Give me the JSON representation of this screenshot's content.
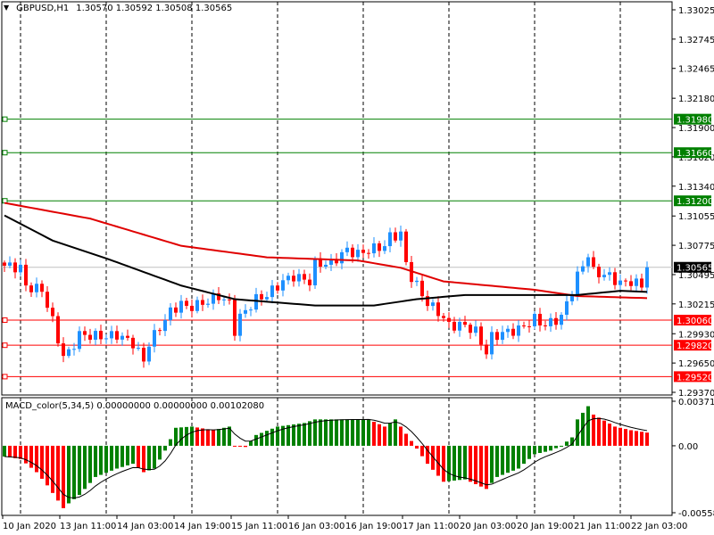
{
  "header": {
    "symbol": "GBPUSD,H1",
    "ohlc": "1.30570 1.30592 1.30508 1.30565"
  },
  "macd_label": "MACD_color(5,34,5) 0.00000000 0.00000000 0.00102080",
  "colors": {
    "up": "#1e90ff",
    "down": "#ff0000",
    "green_line": "#008000",
    "red_line": "#ff0000",
    "ma_slow": "#e00000",
    "ma_fast": "#000000",
    "macd_up": "#008000",
    "macd_down": "#ff0000"
  },
  "chart_data": [
    {
      "type": "candlestick",
      "title": "GBPUSD,H1",
      "ylim": [
        1.2937,
        1.33025
      ],
      "price_ticks": [
        "1.33025",
        "1.32745",
        "1.32465",
        "1.32180",
        "1.31900",
        "1.31620",
        "1.31340",
        "1.31055",
        "1.30775",
        "1.30495",
        "1.30215",
        "1.29930",
        "1.29650",
        "1.29370"
      ],
      "x_labels": [
        "10 Jan 2020",
        "13 Jan 11:00",
        "14 Jan 03:00",
        "14 Jan 19:00",
        "15 Jan 11:00",
        "16 Jan 03:00",
        "16 Jan 19:00",
        "17 Jan 11:00",
        "20 Jan 03:00",
        "20 Jan 19:00",
        "21 Jan 11:00",
        "22 Jan 03:00"
      ],
      "bars": 121,
      "close_keypoints": [
        [
          0,
          1.3058
        ],
        [
          3,
          1.3056
        ],
        [
          4,
          1.3038
        ],
        [
          7,
          1.3035
        ],
        [
          9,
          1.3005
        ],
        [
          11,
          1.2971
        ],
        [
          12,
          1.2975
        ],
        [
          14,
          1.2992
        ],
        [
          19,
          1.299
        ],
        [
          21,
          1.2992
        ],
        [
          24,
          1.2984
        ],
        [
          26,
          1.2967
        ],
        [
          27,
          1.2984
        ],
        [
          29,
          1.2999
        ],
        [
          31,
          1.3014
        ],
        [
          33,
          1.3022
        ],
        [
          34,
          1.3018
        ],
        [
          37,
          1.3022
        ],
        [
          40,
          1.3029
        ],
        [
          42,
          1.3022
        ],
        [
          43,
          1.2996
        ],
        [
          44,
          1.3009
        ],
        [
          47,
          1.3026
        ],
        [
          49,
          1.303
        ],
        [
          52,
          1.3043
        ],
        [
          54,
          1.3048
        ],
        [
          57,
          1.3043
        ],
        [
          58,
          1.306
        ],
        [
          61,
          1.306
        ],
        [
          62,
          1.3065
        ],
        [
          64,
          1.3073
        ],
        [
          66,
          1.3069
        ],
        [
          68,
          1.3073
        ],
        [
          71,
          1.3077
        ],
        [
          72,
          1.3086
        ],
        [
          74,
          1.3088
        ],
        [
          75,
          1.306
        ],
        [
          76,
          1.3047
        ],
        [
          77,
          1.3039
        ],
        [
          79,
          1.3022
        ],
        [
          81,
          1.3014
        ],
        [
          83,
          1.3001
        ],
        [
          86,
          1.3001
        ],
        [
          88,
          1.2995
        ],
        [
          90,
          1.2975
        ],
        [
          91,
          1.299
        ],
        [
          94,
          1.2995
        ],
        [
          96,
          1.2997
        ],
        [
          99,
          1.3007
        ],
        [
          101,
          1.3001
        ],
        [
          104,
          1.3009
        ],
        [
          105,
          1.3022
        ],
        [
          107,
          1.3048
        ],
        [
          109,
          1.3069
        ],
        [
          110,
          1.3052
        ],
        [
          113,
          1.3048
        ],
        [
          115,
          1.3041
        ],
        [
          117,
          1.3043
        ],
        [
          119,
          1.3039
        ],
        [
          120,
          1.30565
        ]
      ],
      "ma_slow_keypoints": [
        [
          0,
          1.3118
        ],
        [
          16,
          1.3103
        ],
        [
          33,
          1.3077
        ],
        [
          49,
          1.3066
        ],
        [
          66,
          1.3063
        ],
        [
          74,
          1.3056
        ],
        [
          82,
          1.3043
        ],
        [
          99,
          1.3035
        ],
        [
          107,
          1.3029
        ],
        [
          120,
          1.3027
        ]
      ],
      "ma_fast_keypoints": [
        [
          0,
          1.3106
        ],
        [
          9,
          1.3082
        ],
        [
          19,
          1.3065
        ],
        [
          33,
          1.3039
        ],
        [
          43,
          1.3026
        ],
        [
          58,
          1.302
        ],
        [
          69,
          1.302
        ],
        [
          77,
          1.3026
        ],
        [
          86,
          1.303
        ],
        [
          107,
          1.303
        ],
        [
          115,
          1.3034
        ],
        [
          120,
          1.3033
        ]
      ],
      "hlines": [
        {
          "price": "1.31980",
          "color": "green"
        },
        {
          "price": "1.31660",
          "color": "green"
        },
        {
          "price": "1.31200",
          "color": "green"
        },
        {
          "price": "1.30060",
          "color": "red"
        },
        {
          "price": "1.29820",
          "color": "red"
        },
        {
          "price": "1.29520",
          "color": "red"
        }
      ],
      "current_price": "1.30565"
    },
    {
      "type": "bar",
      "title": "MACD_color(5,34,5)",
      "ylim": [
        -0.005581,
        0.0037136
      ],
      "ticks": [
        "0.0037136",
        "0.00",
        "-0.005581"
      ],
      "hist_keypoints": [
        [
          0,
          -0.0009
        ],
        [
          3,
          -0.0011
        ],
        [
          6,
          -0.0022
        ],
        [
          8,
          -0.0033
        ],
        [
          11,
          -0.0052
        ],
        [
          12,
          -0.0048
        ],
        [
          14,
          -0.0041
        ],
        [
          17,
          -0.0026
        ],
        [
          21,
          -0.0019
        ],
        [
          24,
          -0.0015
        ],
        [
          26,
          -0.0022
        ],
        [
          28,
          -0.0019
        ],
        [
          30,
          -0.0004
        ],
        [
          32,
          0.0015
        ],
        [
          35,
          0.0016
        ],
        [
          39,
          0.0013
        ],
        [
          42,
          0.0016
        ],
        [
          43,
          0.0
        ],
        [
          45,
          -0.0001
        ],
        [
          47,
          0.0009
        ],
        [
          51,
          0.0016
        ],
        [
          56,
          0.0019
        ],
        [
          58,
          0.0022
        ],
        [
          62,
          0.0022
        ],
        [
          68,
          0.0022
        ],
        [
          71,
          0.0016
        ],
        [
          73,
          0.0022
        ],
        [
          76,
          0.0004
        ],
        [
          79,
          -0.0015
        ],
        [
          82,
          -0.003
        ],
        [
          86,
          -0.0028
        ],
        [
          90,
          -0.0036
        ],
        [
          92,
          -0.0026
        ],
        [
          96,
          -0.0019
        ],
        [
          99,
          -0.0007
        ],
        [
          102,
          -0.0004
        ],
        [
          104,
          0.0
        ],
        [
          106,
          0.0007
        ],
        [
          107,
          0.0022
        ],
        [
          109,
          0.0033
        ],
        [
          110,
          0.0026
        ],
        [
          114,
          0.0016
        ],
        [
          117,
          0.0013
        ],
        [
          120,
          0.0011
        ]
      ]
    }
  ]
}
